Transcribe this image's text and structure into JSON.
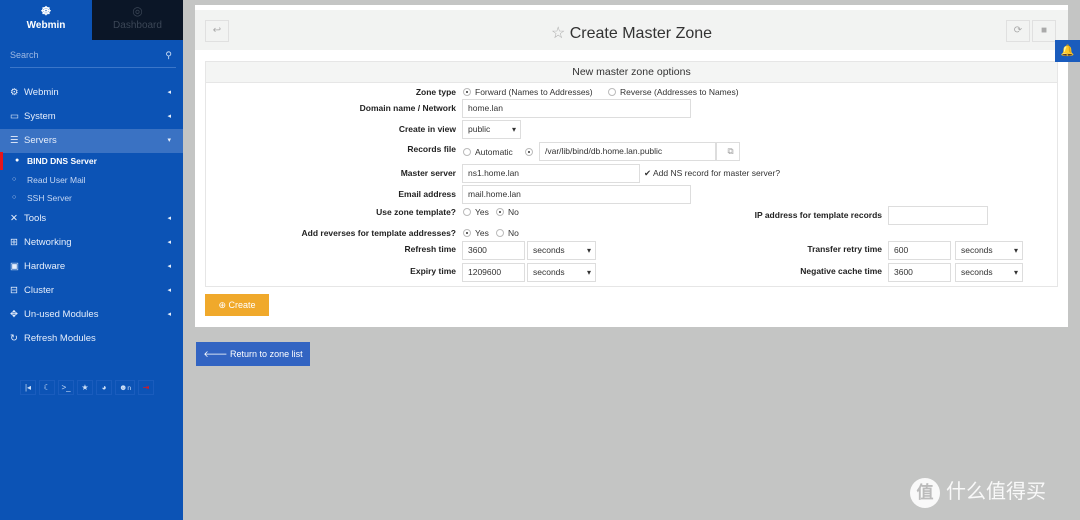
{
  "sidebar": {
    "brand": "Webmin",
    "dashboard": "Dashboard",
    "search_placeholder": "Search",
    "items": [
      {
        "label": "Webmin",
        "icon": "gear-icon"
      },
      {
        "label": "System",
        "icon": "laptop-icon"
      },
      {
        "label": "Servers",
        "icon": "server-icon"
      },
      {
        "label": "Tools",
        "icon": "wrench-icon"
      },
      {
        "label": "Networking",
        "icon": "network-icon"
      },
      {
        "label": "Hardware",
        "icon": "hdd-icon"
      },
      {
        "label": "Cluster",
        "icon": "cluster-icon"
      },
      {
        "label": "Un-used Modules",
        "icon": "puzzle-icon"
      },
      {
        "label": "Refresh Modules",
        "icon": "refresh-icon"
      }
    ],
    "subitems": [
      "BIND DNS Server",
      "Read User Mail",
      "SSH Server"
    ],
    "bottom_user": "n"
  },
  "page": {
    "title": "Create Master Zone",
    "section": "New master zone options"
  },
  "form": {
    "zone_type_label": "Zone type",
    "zone_forward": "Forward (Names to Addresses)",
    "zone_reverse": "Reverse (Addresses to Names)",
    "domain_label": "Domain name / Network",
    "domain_value": "home.lan",
    "view_label": "Create in view",
    "view_value": "public",
    "records_label": "Records file",
    "records_auto": "Automatic",
    "records_value": "/var/lib/bind/db.home.lan.public",
    "master_label": "Master server",
    "master_value": "ns1.home.lan",
    "add_ns": "Add NS record for master server?",
    "email_label": "Email address",
    "email_value": "mail.home.lan",
    "template_label": "Use zone template?",
    "yes": "Yes",
    "no": "No",
    "ip_template_label": "IP address for template records",
    "reverses_label": "Add reverses for template addresses?",
    "refresh_label": "Refresh time",
    "refresh_value": "3600",
    "refresh_unit": "seconds",
    "retry_label": "Transfer retry time",
    "retry_value": "600",
    "retry_unit": "seconds",
    "expiry_label": "Expiry time",
    "expiry_value": "1209600",
    "expiry_unit": "seconds",
    "negcache_label": "Negative cache time",
    "negcache_value": "3600",
    "negcache_unit": "seconds"
  },
  "buttons": {
    "create": "Create",
    "return": "Return to zone list"
  },
  "watermark": "什么值得买",
  "watermark_logo": "值"
}
